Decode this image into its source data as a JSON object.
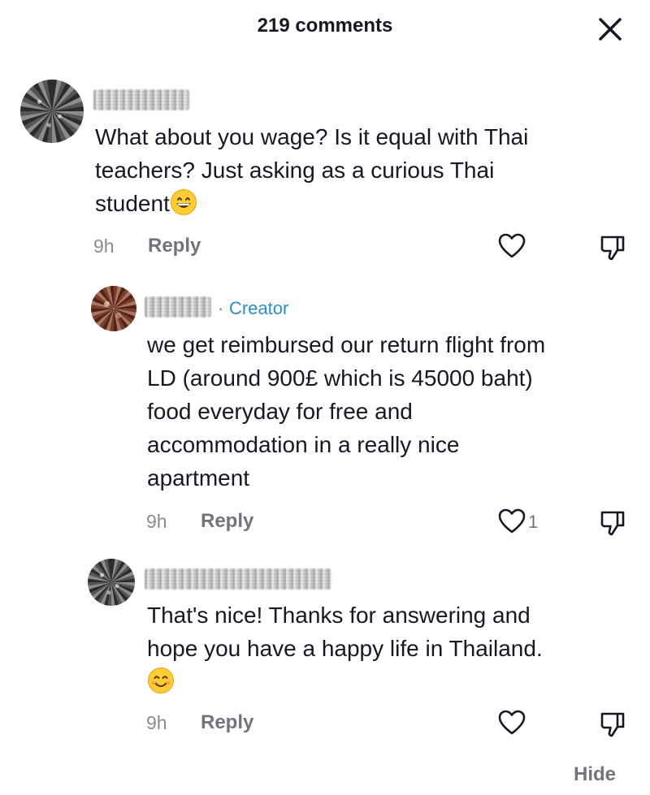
{
  "header": {
    "title": "219 comments",
    "close_icon": "close-icon"
  },
  "comments": [
    {
      "text": "What about you wage? Is it equal with Thai teachers? Just asking as a curious Thai student",
      "lines": [
        "What about you wage? Is it equal with Thai",
        "teachers? Just asking as a curious Thai",
        "student"
      ],
      "emoji": "grinning-face-emoji",
      "time": "9h",
      "reply_label": "Reply",
      "like_icon": "heart-icon",
      "dislike_icon": "thumbs-down-icon"
    },
    {
      "creator_label": "Creator",
      "creator_separator": "·",
      "lines": [
        "we get reimbursed our return flight from",
        "LD (around 900£ which is 45000 baht)",
        "food everyday for free and",
        "accommodation in a really nice",
        "apartment"
      ],
      "time": "9h",
      "reply_label": "Reply",
      "like_count": "1",
      "like_icon": "heart-icon",
      "dislike_icon": "thumbs-down-icon"
    },
    {
      "lines": [
        "That's nice! Thanks for answering and",
        "hope you have a happy life in Thailand."
      ],
      "emoji": "smiling-face-emoji",
      "time": "9h",
      "reply_label": "Reply",
      "like_icon": "heart-icon",
      "dislike_icon": "thumbs-down-icon"
    }
  ],
  "footer": {
    "hide_label": "Hide"
  },
  "colors": {
    "text": "#161823",
    "muted": "#73747b",
    "creator": "#2a8ec9"
  }
}
